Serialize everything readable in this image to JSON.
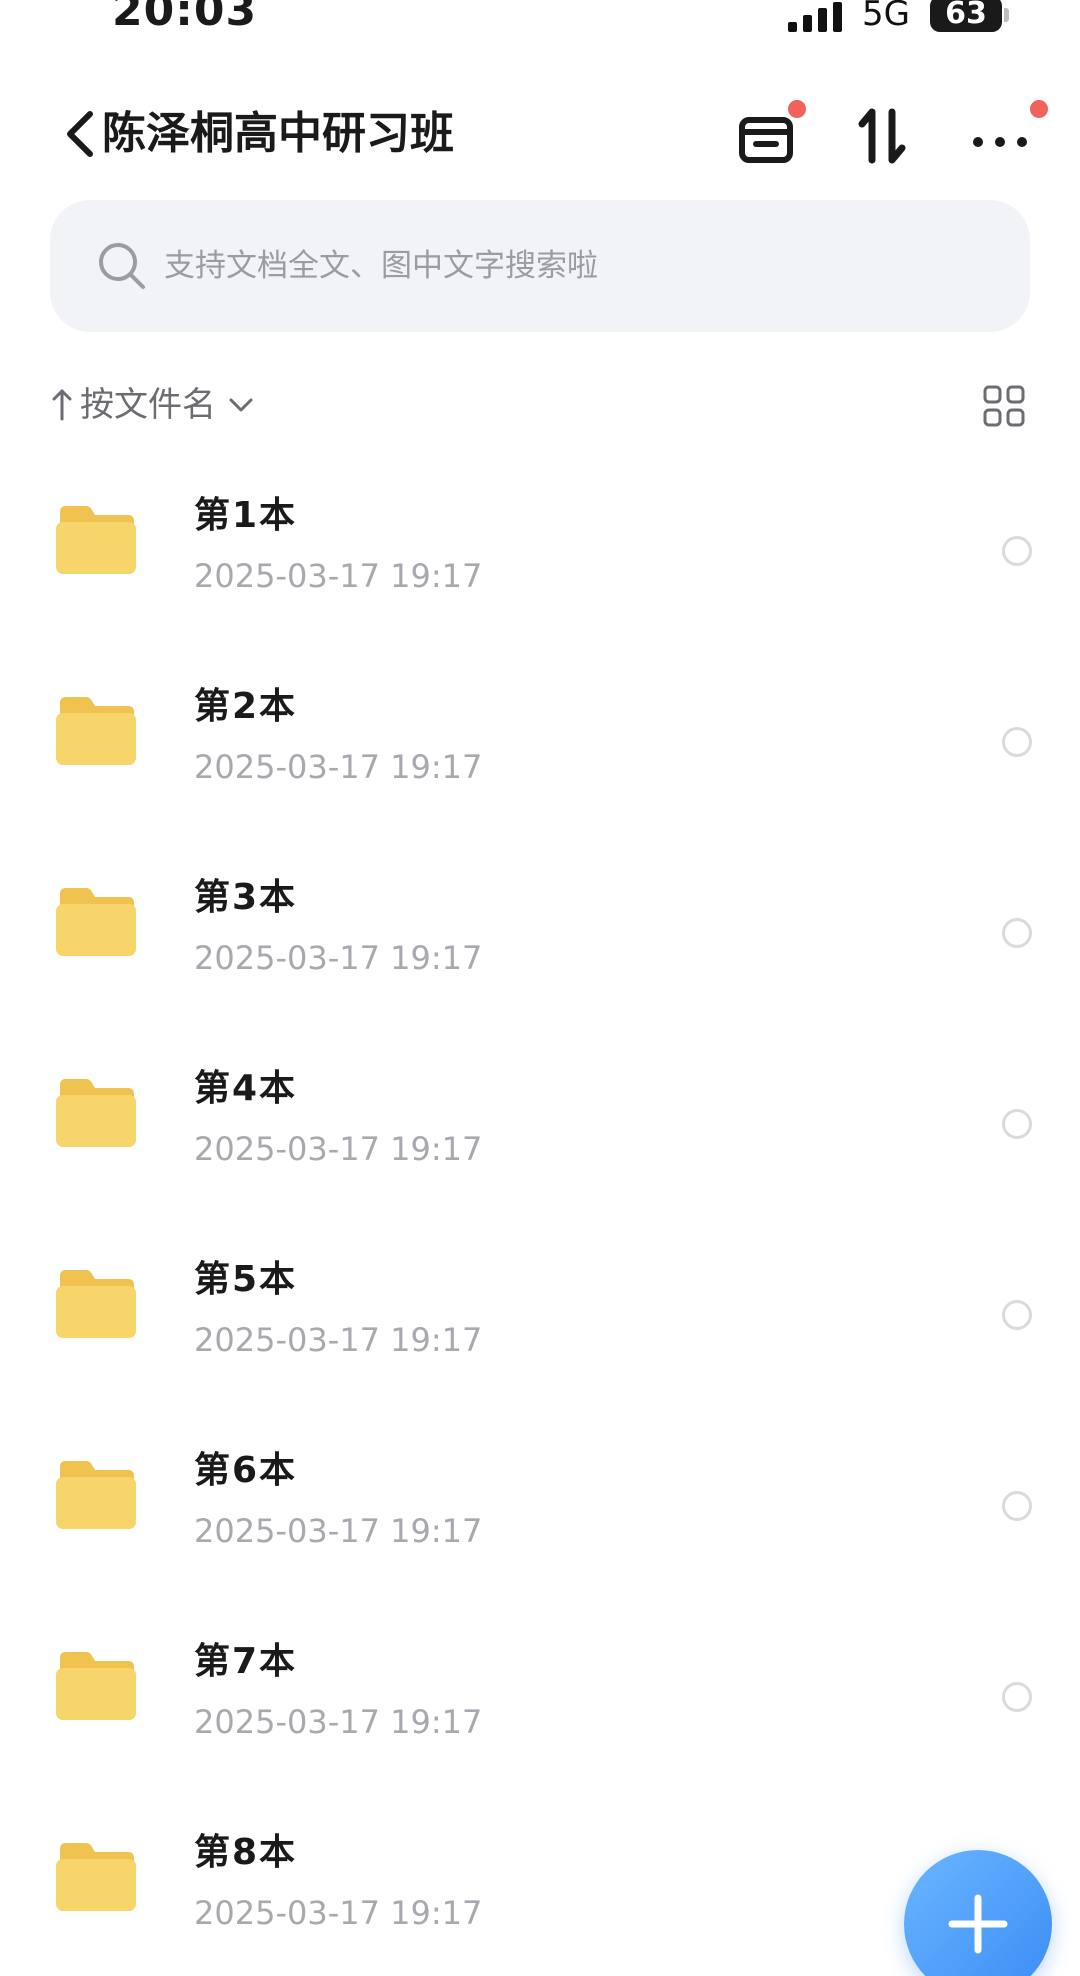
{
  "status_bar": {
    "time": "20:03",
    "network": "5G",
    "battery": "63"
  },
  "header": {
    "title": "陈泽桐高中研习班",
    "icons": [
      "back-chevron-icon",
      "inbox-icon",
      "sort-transfer-icon",
      "more-icon"
    ],
    "notification_dot_color": "#f0625b"
  },
  "search": {
    "placeholder": "支持文档全文、图中文字搜索啦"
  },
  "sort": {
    "label": "按文件名",
    "icons": [
      "arrow-up-icon",
      "chevron-down-icon",
      "grid-view-icon"
    ]
  },
  "files": [
    {
      "name": "第1本",
      "date": "2025-03-17 19:17"
    },
    {
      "name": "第2本",
      "date": "2025-03-17 19:17"
    },
    {
      "name": "第3本",
      "date": "2025-03-17 19:17"
    },
    {
      "name": "第4本",
      "date": "2025-03-17 19:17"
    },
    {
      "name": "第5本",
      "date": "2025-03-17 19:17"
    },
    {
      "name": "第6本",
      "date": "2025-03-17 19:17"
    },
    {
      "name": "第7本",
      "date": "2025-03-17 19:17"
    },
    {
      "name": "第8本",
      "date": "2025-03-17 19:17"
    }
  ],
  "colors": {
    "folder": "#f7d56a",
    "accent": "#3b8cf6",
    "search_bg": "#f2f3f7"
  },
  "fab_icon": "plus-icon"
}
